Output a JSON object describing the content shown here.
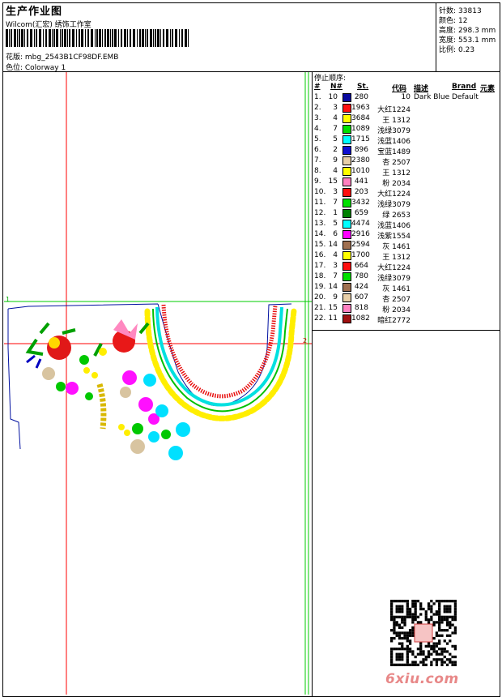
{
  "header": {
    "title": "生产作业图",
    "company": "Wilcom(汇宏) 绣饰工作室",
    "design_file": "花版: mbg_2543B1CF98DF.EMB",
    "colorway": "色位: Colorway 1"
  },
  "stats": [
    {
      "label": "针数:",
      "value": "33813"
    },
    {
      "label": "颜色:",
      "value": "12"
    },
    {
      "label": "高度:",
      "value": "298.3 mm"
    },
    {
      "label": "宽度:",
      "value": "553.1 mm"
    },
    {
      "label": "比例:",
      "value": "0.23"
    }
  ],
  "stop_sequence": {
    "title": "停止顺序:",
    "headers": [
      "#",
      "N#",
      "St.",
      "代码",
      "描述",
      "Brand",
      "元素"
    ],
    "rows": [
      {
        "idx": "1.",
        "n": "10",
        "color": "#0a0aa0",
        "st": "280",
        "code": "10",
        "desc": "Dark Blue",
        "brand": "Default"
      },
      {
        "idx": "2.",
        "n": "3",
        "color": "#ff1010",
        "st": "1963",
        "code": "大红1224",
        "desc": "",
        "brand": ""
      },
      {
        "idx": "3.",
        "n": "4",
        "color": "#ffff00",
        "st": "3684",
        "code": "王 1312",
        "desc": "",
        "brand": ""
      },
      {
        "idx": "4.",
        "n": "7",
        "color": "#00e000",
        "st": "1089",
        "code": "浅绿3079",
        "desc": "",
        "brand": ""
      },
      {
        "idx": "5.",
        "n": "5",
        "color": "#00ffff",
        "st": "1715",
        "code": "浅蓝1406",
        "desc": "",
        "brand": ""
      },
      {
        "idx": "6.",
        "n": "2",
        "color": "#1010d0",
        "st": "896",
        "code": "宝蓝1489",
        "desc": "",
        "brand": ""
      },
      {
        "idx": "7.",
        "n": "9",
        "color": "#e8cfa8",
        "st": "2380",
        "code": "杏 2507",
        "desc": "",
        "brand": ""
      },
      {
        "idx": "8.",
        "n": "4",
        "color": "#ffff00",
        "st": "1010",
        "code": "王 1312",
        "desc": "",
        "brand": ""
      },
      {
        "idx": "9.",
        "n": "15",
        "color": "#ff80c0",
        "st": "441",
        "code": "粉 2034",
        "desc": "",
        "brand": ""
      },
      {
        "idx": "10.",
        "n": "3",
        "color": "#ff1010",
        "st": "203",
        "code": "大红1224",
        "desc": "",
        "brand": ""
      },
      {
        "idx": "11.",
        "n": "7",
        "color": "#00e000",
        "st": "3432",
        "code": "浅绿3079",
        "desc": "",
        "brand": ""
      },
      {
        "idx": "12.",
        "n": "1",
        "color": "#008000",
        "st": "659",
        "code": "绿 2653",
        "desc": "",
        "brand": ""
      },
      {
        "idx": "13.",
        "n": "5",
        "color": "#00ffff",
        "st": "4474",
        "code": "浅蓝1406",
        "desc": "",
        "brand": ""
      },
      {
        "idx": "14.",
        "n": "6",
        "color": "#ff00ff",
        "st": "2916",
        "code": "浅紫1554",
        "desc": "",
        "brand": ""
      },
      {
        "idx": "15.",
        "n": "14",
        "color": "#a07050",
        "st": "2594",
        "code": "灰 1461",
        "desc": "",
        "brand": ""
      },
      {
        "idx": "16.",
        "n": "4",
        "color": "#ffff00",
        "st": "1700",
        "code": "王 1312",
        "desc": "",
        "brand": ""
      },
      {
        "idx": "17.",
        "n": "3",
        "color": "#ff1010",
        "st": "664",
        "code": "大红1224",
        "desc": "",
        "brand": ""
      },
      {
        "idx": "18.",
        "n": "7",
        "color": "#00e000",
        "st": "780",
        "code": "浅绿3079",
        "desc": "",
        "brand": ""
      },
      {
        "idx": "19.",
        "n": "14",
        "color": "#a07050",
        "st": "424",
        "code": "灰 1461",
        "desc": "",
        "brand": ""
      },
      {
        "idx": "20.",
        "n": "9",
        "color": "#e8cfa8",
        "st": "607",
        "code": "杏 2507",
        "desc": "",
        "brand": ""
      },
      {
        "idx": "21.",
        "n": "15",
        "color": "#ff80c0",
        "st": "818",
        "code": "粉 2034",
        "desc": "",
        "brand": ""
      },
      {
        "idx": "22.",
        "n": "11",
        "color": "#a01010",
        "st": "1082",
        "code": "暗红2772",
        "desc": "",
        "brand": ""
      }
    ]
  },
  "canvas_markers": {
    "guide_start": "1",
    "guide_end": "2"
  },
  "watermark": "6xiu.com",
  "icons": {
    "barcode": "barcode-icon",
    "qr": "qr-code-icon",
    "preview": "embroidery-preview"
  }
}
